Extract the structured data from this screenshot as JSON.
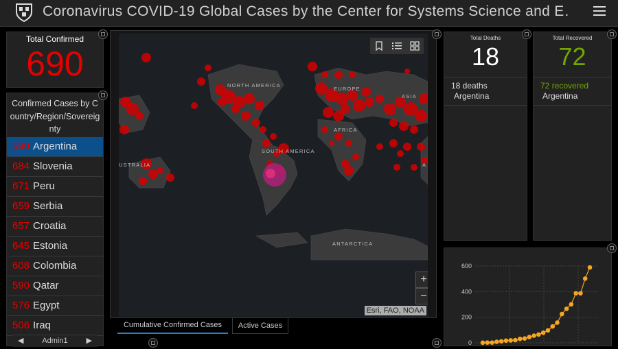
{
  "header": {
    "title": "Coronavirus COVID-19 Global Cases by the Center for Systems Science and E…"
  },
  "total_confirmed": {
    "label": "Total Confirmed",
    "value": "690"
  },
  "country_list": {
    "title": "Confirmed Cases by Country/Region/Sovereignty",
    "items": [
      {
        "count": "690",
        "name": "Argentina"
      },
      {
        "count": "684",
        "name": "Slovenia"
      },
      {
        "count": "671",
        "name": "Peru"
      },
      {
        "count": "659",
        "name": "Serbia"
      },
      {
        "count": "657",
        "name": "Croatia"
      },
      {
        "count": "645",
        "name": "Estonia"
      },
      {
        "count": "608",
        "name": "Colombia"
      },
      {
        "count": "590",
        "name": "Qatar"
      },
      {
        "count": "576",
        "name": "Egypt"
      },
      {
        "count": "506",
        "name": "Iraq"
      }
    ],
    "selected_index": 0,
    "footer_label": "Admin1"
  },
  "map": {
    "labels": {
      "north_america": "NORTH AMERICA",
      "south_america": "SOUTH AMERICA",
      "europe": "EUROPE",
      "africa": "AFRICA",
      "asia": "ASIA",
      "australia": "USTRALIA",
      "antarctica": "ANTARCTICA",
      "edge_a": "A"
    },
    "attribution": "Esri, FAO, NOAA",
    "zoom_in": "+",
    "zoom_out": "−",
    "colors": {
      "dot": "#d40000",
      "highlight": "#b0207a",
      "land": "#3b3b3b",
      "water": "#1c2025"
    }
  },
  "tabs": [
    {
      "label": "Cumulative Confirmed Cases",
      "active": true
    },
    {
      "label": "Active Cases",
      "active": false
    }
  ],
  "deaths": {
    "label": "Total Deaths",
    "value": "18",
    "detail_count": "18 deaths",
    "detail_place": "Argentina"
  },
  "recovered": {
    "label": "Total Recovered",
    "value": "72",
    "detail_count": "72",
    "detail_word": "recovered",
    "detail_place": "Argentina",
    "color": "#70a800"
  },
  "chart_data": {
    "type": "line",
    "y_ticks": [
      "600",
      "400",
      "200",
      "0"
    ],
    "ylim": [
      0,
      600
    ],
    "x": [
      1,
      2,
      3,
      4,
      5,
      6,
      7,
      8,
      9,
      10,
      11,
      12,
      13,
      14,
      15,
      16,
      17,
      18,
      19,
      20,
      21,
      22
    ],
    "values": [
      1,
      2,
      2,
      8,
      12,
      17,
      19,
      21,
      31,
      34,
      45,
      56,
      65,
      79,
      97,
      128,
      158,
      225,
      266,
      301,
      387,
      387,
      502,
      589
    ],
    "color": "#f5a623"
  }
}
